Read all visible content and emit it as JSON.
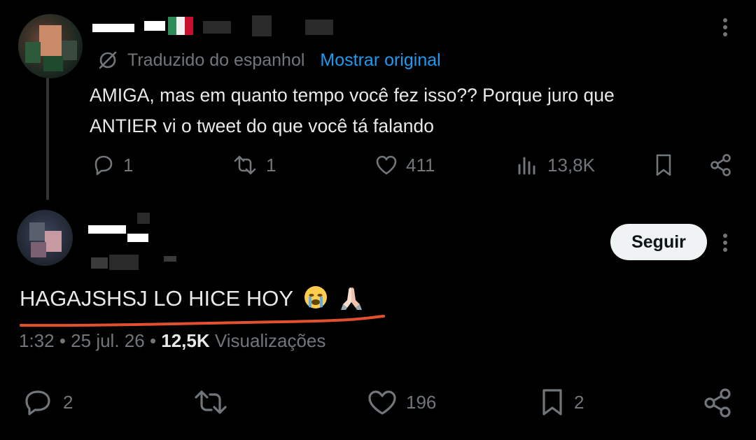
{
  "colors": {
    "background": "#000000",
    "text": "#e7e9ea",
    "muted": "#71767b",
    "link": "#1d9bf0",
    "annotation": "#e2502f",
    "follow_button_bg": "#eff3f4"
  },
  "reply_tweet": {
    "translation_label": "Traduzido do espanhol",
    "show_original": "Mostrar original",
    "text_line1": "AMIGA, mas em quanto tempo você fez isso?? Porque juro que",
    "text_line2": "ANTIER vi o tweet do que você tá falando",
    "replies": "1",
    "reposts": "1",
    "likes": "411",
    "views": "13,8K",
    "icons": [
      "translate-icon",
      "reply-icon",
      "repost-icon",
      "like-icon",
      "views-icon",
      "bookmark-icon",
      "share-icon",
      "more-icon"
    ]
  },
  "main_tweet": {
    "follow_label": "Seguir",
    "text": "HAGAJSHSJ LO HICE HOY",
    "emojis": [
      "loudly-crying-face-emoji",
      "folded-hands-emoji"
    ],
    "time": "1:32",
    "date": "25 jul. 26",
    "views_count": "12,5K",
    "views_label": "Visualizações",
    "replies": "2",
    "likes": "196",
    "bookmarks": "2",
    "icons": [
      "reply-icon",
      "repost-icon",
      "like-icon",
      "bookmark-icon",
      "share-icon",
      "more-icon"
    ]
  }
}
